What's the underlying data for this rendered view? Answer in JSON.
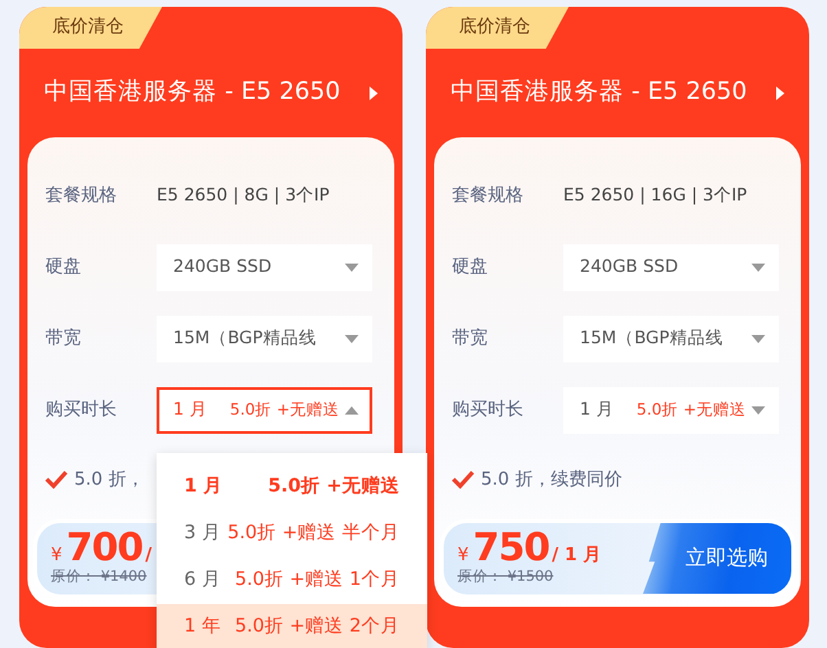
{
  "cards": [
    {
      "tag": "底价清仓",
      "title": "中国香港服务器 - E5 2650",
      "specs": [
        {
          "kind": "text",
          "label": "套餐规格",
          "value": "E5 2650 | 8G | 3个IP"
        },
        {
          "kind": "select",
          "label": "硬盘",
          "value": "240GB SSD",
          "open": false
        },
        {
          "kind": "select",
          "label": "带宽",
          "value": "15M（BGP精品线",
          "open": false
        },
        {
          "kind": "duration",
          "label": "购买时长",
          "value": "1 月",
          "offer": "5.0折 +无赠送",
          "open": true
        }
      ],
      "dropdown": [
        {
          "period": "1 月",
          "offer": "5.0折 +无赠送",
          "selected": true,
          "hovered": false
        },
        {
          "period": "3 月",
          "offer": "5.0折 +赠送 半个月",
          "selected": false,
          "hovered": false
        },
        {
          "period": "6 月",
          "offer": "5.0折 +赠送 1个月",
          "selected": false,
          "hovered": false
        },
        {
          "period": "1 年",
          "offer": "5.0折 +赠送 2个月",
          "selected": false,
          "hovered": true
        }
      ],
      "note": "5.0 折，",
      "price": {
        "currency": "¥",
        "amount": "700",
        "unit": "/",
        "original": "原价： ¥1400"
      }
    },
    {
      "tag": "底价清仓",
      "title": "中国香港服务器 - E5 2650",
      "specs": [
        {
          "kind": "text",
          "label": "套餐规格",
          "value": "E5 2650 | 16G | 3个IP"
        },
        {
          "kind": "select",
          "label": "硬盘",
          "value": "240GB SSD",
          "open": false
        },
        {
          "kind": "select",
          "label": "带宽",
          "value": "15M（BGP精品线",
          "open": false
        },
        {
          "kind": "duration",
          "label": "购买时长",
          "value": "1 月",
          "offer": "5.0折 +无赠送",
          "open": false
        }
      ],
      "note": "5.0 折，续费同价",
      "price": {
        "currency": "¥",
        "amount": "750",
        "unit": "/ 1 月",
        "original": "原价： ¥1500"
      },
      "buy_button": "立即选购"
    }
  ]
}
